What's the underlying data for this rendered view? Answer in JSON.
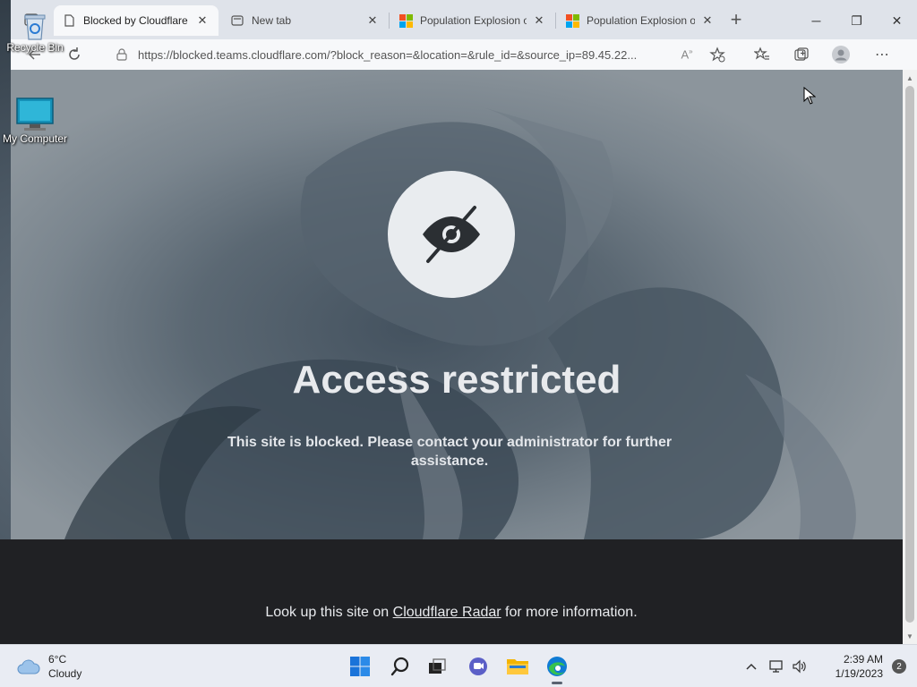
{
  "desktop": {
    "icons": [
      {
        "label": "Recycle Bin"
      },
      {
        "label": "My Computer"
      }
    ]
  },
  "browser": {
    "tabs": [
      {
        "label": "Blocked by Cloudflare G",
        "icon": "page-icon",
        "active": true
      },
      {
        "label": "New tab",
        "icon": "new-tab-icon",
        "active": false
      },
      {
        "label": "Population Explosion of",
        "icon": "microsoft-logo-icon",
        "active": false
      },
      {
        "label": "Population Explosion of",
        "icon": "microsoft-logo-icon",
        "active": false
      }
    ],
    "new_tab_symbol": "+",
    "url": "https://blocked.teams.cloudflare.com/?block_reason=&location=&rule_id=&source_ip=89.45.22...",
    "window_controls": {
      "minimize": "─",
      "restore": "❐",
      "close": "✕"
    }
  },
  "page": {
    "title": "Access restricted",
    "message": "This site is blocked. Please contact your administrator for further assistance.",
    "footer": {
      "before_link": "Look up this site on ",
      "link_text": "Cloudflare Radar",
      "after_link": " for more information."
    }
  },
  "taskbar": {
    "weather": {
      "temperature": "6°C",
      "condition": "Cloudy"
    },
    "clock": {
      "time": "2:39 AM",
      "date": "1/19/2023"
    },
    "notification_count": "2"
  },
  "colors": {
    "footer_bg": "#202124",
    "badge_bg": "#e9ecef",
    "accent_edge": "#0f7bd4"
  }
}
